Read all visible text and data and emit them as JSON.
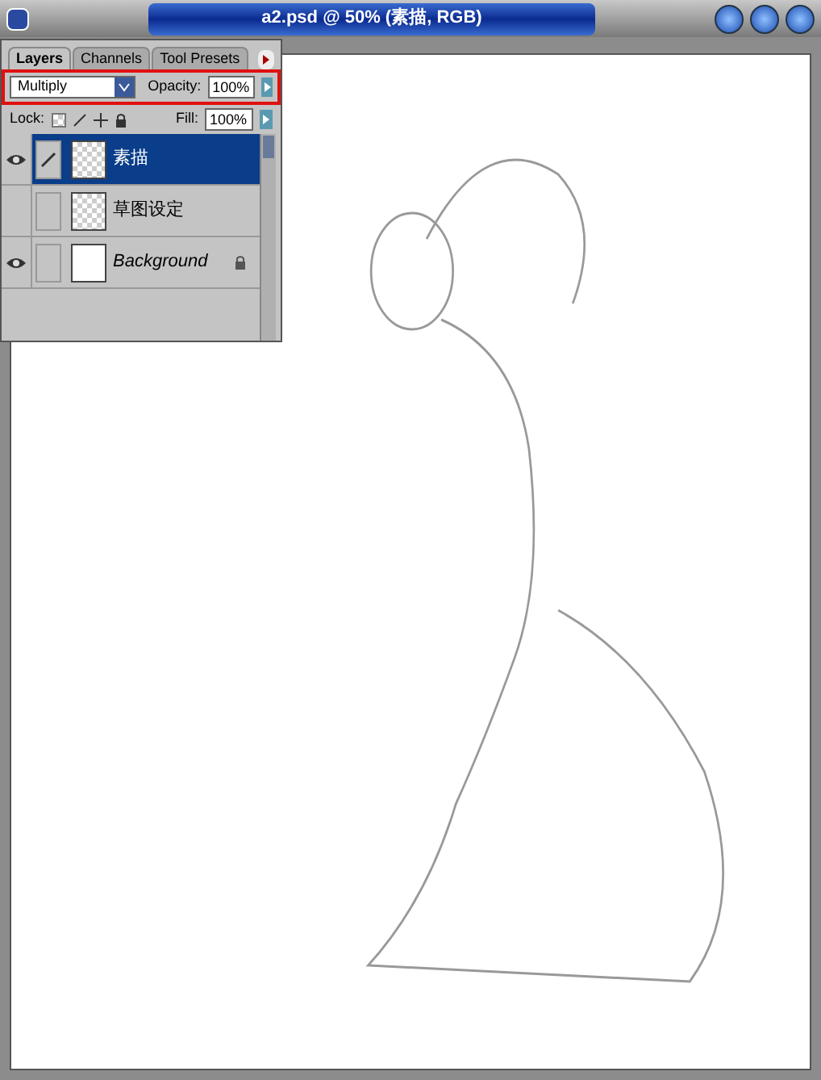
{
  "window": {
    "title": "a2.psd @ 50% (素描, RGB)"
  },
  "layers_panel": {
    "tabs": [
      {
        "label": "Layers",
        "selected": true
      },
      {
        "label": "Channels",
        "selected": false
      },
      {
        "label": "Tool Presets",
        "selected": false
      }
    ],
    "blend_mode": "Multiply",
    "blend_highlighted": true,
    "opacity_label": "Opacity:",
    "opacity": "100%",
    "lock_label": "Lock:",
    "fill_label": "Fill:",
    "fill": "100%",
    "layers": [
      {
        "name": "素描",
        "visible": true,
        "linked": true,
        "selected": true,
        "locked": false,
        "kind": "transparent"
      },
      {
        "name": "草图设定",
        "visible": false,
        "linked": false,
        "selected": false,
        "locked": false,
        "kind": "transparent"
      },
      {
        "name": "Background",
        "visible": true,
        "linked": false,
        "selected": false,
        "locked": true,
        "kind": "background"
      }
    ]
  }
}
